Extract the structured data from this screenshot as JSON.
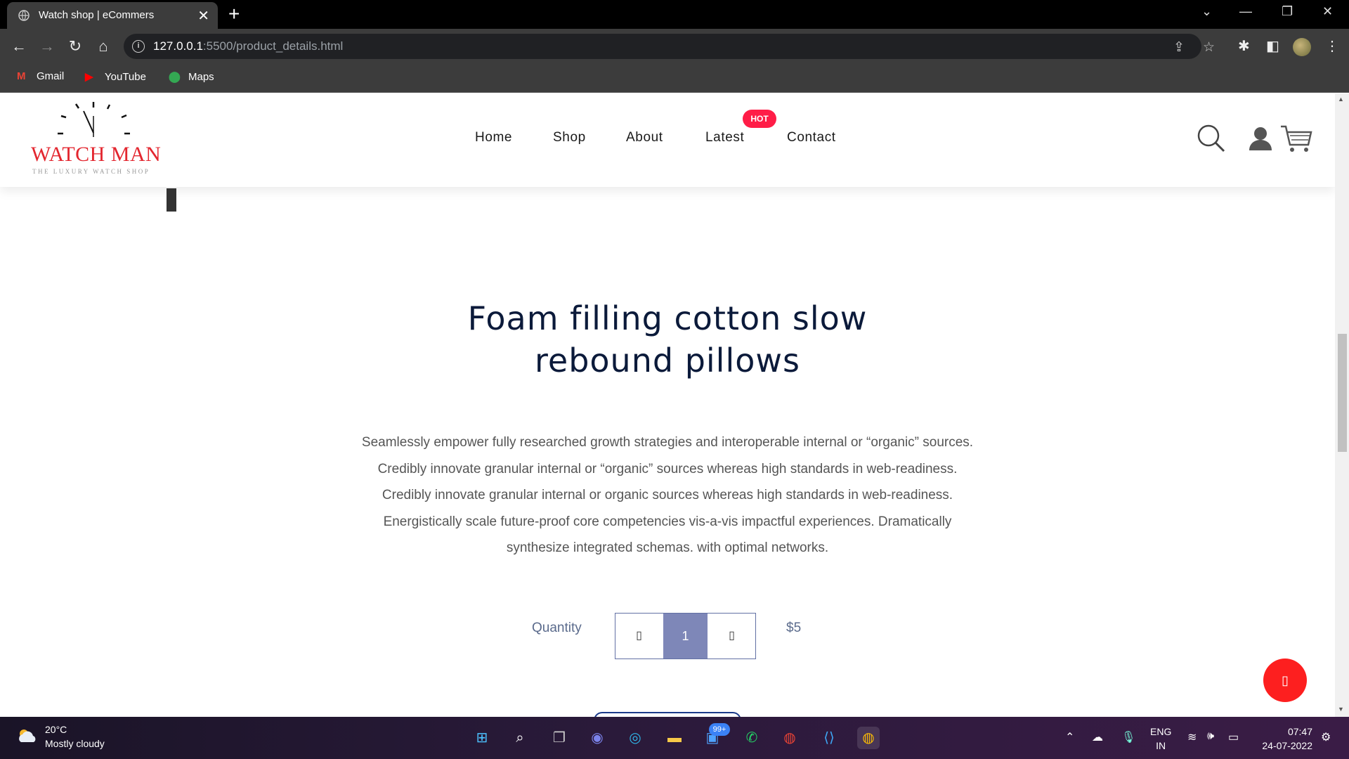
{
  "browser": {
    "tab_title": "Watch shop | eCommers",
    "tab_close": "✕",
    "new_tab": "+",
    "url_host": "127.0.0.1",
    "url_rest": ":5500/product_details.html",
    "bookmarks": [
      {
        "label": "Gmail",
        "icon": "gmail-icon"
      },
      {
        "label": "YouTube",
        "icon": "youtube-icon"
      },
      {
        "label": "Maps",
        "icon": "maps-icon"
      }
    ]
  },
  "site": {
    "logo_brand": "WATCH MAN",
    "logo_tagline": "THE LUXURY WATCH SHOP",
    "nav": [
      "Home",
      "Shop",
      "About",
      "Latest",
      "Contact"
    ],
    "hot_badge": "HOT"
  },
  "product": {
    "title_line1": "Foam filling cotton slow",
    "title_line2": "rebound pillows",
    "description": [
      "Seamlessly empower fully researched growth strategies and interoperable internal or “organic” sources.",
      "Credibly innovate granular internal or “organic” sources whereas high standards in web-readiness.",
      "Credibly innovate granular internal or organic sources whereas high standards in web-readiness.",
      "Energistically scale future-proof core competencies vis-a-vis impactful experiences. Dramatically",
      "synthesize integrated schemas. with optimal networks."
    ],
    "quantity_label": "Quantity",
    "quantity": "1",
    "price": "$5"
  },
  "taskbar": {
    "temperature": "20°C",
    "weather": "Mostly cloudy",
    "notification_badge": "99+",
    "lang_1": "ENG",
    "lang_2": "IN",
    "time": "07:47",
    "date": "24-07-2022"
  },
  "colors": {
    "accent": "#ff1d47",
    "brand_red": "#e3262f",
    "qty_active": "#7e87b8",
    "float_button": "#fd1f1f"
  }
}
